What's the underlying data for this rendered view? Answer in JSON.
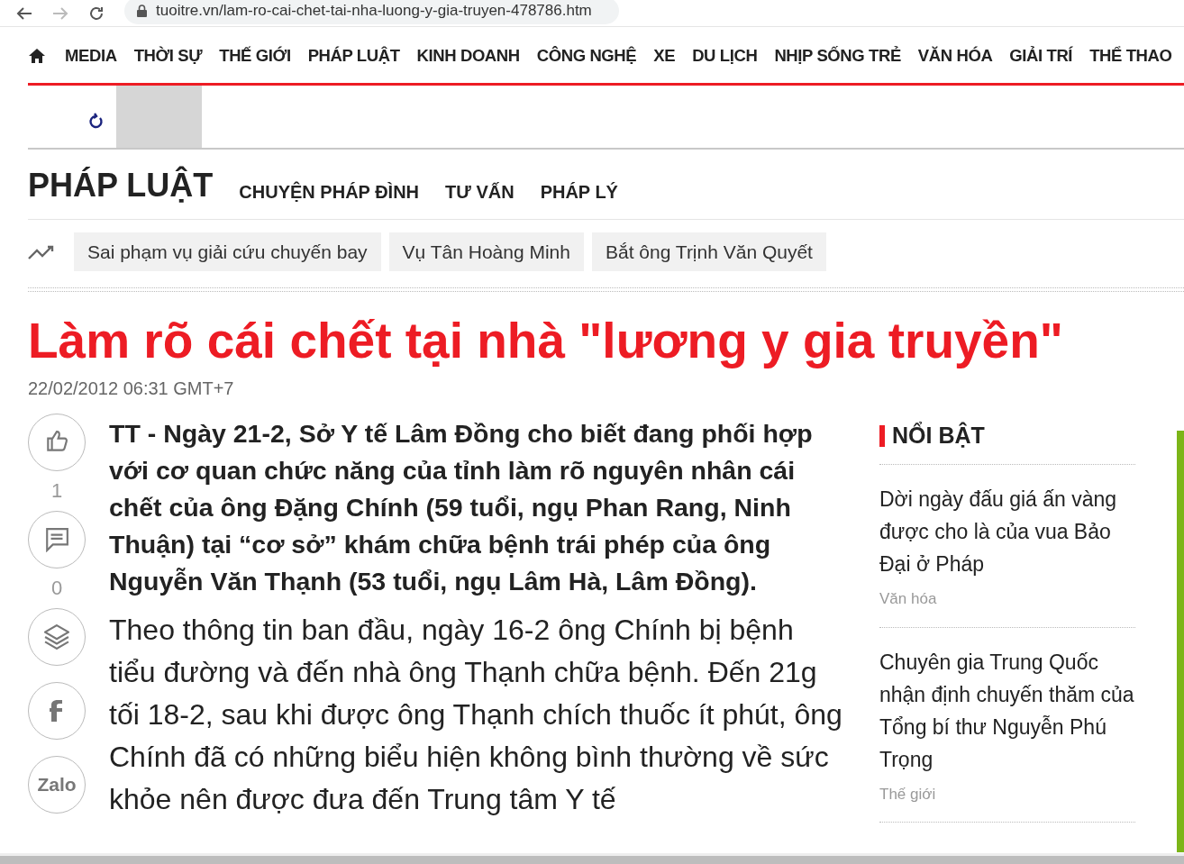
{
  "browser": {
    "url": "tuoitre.vn/lam-ro-cai-chet-tai-nha-luong-y-gia-truyen-478786.htm",
    "back_disabled": false,
    "forward_disabled": true
  },
  "nav": {
    "items": [
      "MEDIA",
      "THỜI SỰ",
      "THẾ GIỚI",
      "PHÁP LUẬT",
      "KINH DOANH",
      "CÔNG NGHỆ",
      "XE",
      "DU LỊCH",
      "NHỊP SỐNG TRẺ",
      "VĂN HÓA",
      "GIẢI TRÍ",
      "THỂ THAO"
    ]
  },
  "section": {
    "title": "PHÁP LUẬT",
    "subsections": [
      "CHUYỆN PHÁP ĐÌNH",
      "TƯ VẤN",
      "PHÁP LÝ"
    ]
  },
  "trending_tags": [
    "Sai phạm vụ giải cứu chuyến bay",
    "Vụ Tân Hoàng Minh",
    "Bắt ông Trịnh Văn Quyết"
  ],
  "article": {
    "title": "Làm rõ cái chết tại nhà \"lương y gia truyền\"",
    "date": "22/02/2012 06:31 GMT+7",
    "lead": "TT - Ngày 21-2, Sở Y tế Lâm Đồng cho biết đang phối hợp với cơ quan chức năng của tỉnh làm rõ nguyên nhân cái chết của ông Đặng Chính (59 tuổi, ngụ Phan Rang, Ninh Thuận) tại “cơ sở” khám chữa bệnh trái phép của ông Nguyễn Văn Thạnh (53 tuổi, ngụ Lâm Hà, Lâm Đồng).",
    "body": "Theo thông tin ban đầu, ngày 16-2 ông Chính bị bệnh tiểu đường và đến nhà ông Thạnh chữa bệnh. Đến 21g tối 18-2, sau khi được ông Thạnh chích thuốc ít phút, ông Chính đã có những biểu hiện không bình thường về sức khỏe nên được đưa đến Trung tâm Y tế"
  },
  "share_bar": [
    {
      "kind": "like",
      "count": "1"
    },
    {
      "kind": "comment",
      "count": "0"
    },
    {
      "kind": "layers"
    },
    {
      "kind": "facebook"
    },
    {
      "kind": "zalo",
      "label": "Zalo"
    }
  ],
  "featured": {
    "title": "NỔI BẬT",
    "items": [
      {
        "title": "Dời ngày đấu giá ấn vàng được cho là của vua Bảo Đại ở Pháp",
        "category": "Văn hóa"
      },
      {
        "title": "Chuyên gia Trung Quốc nhận định chuyến thăm của Tổng bí thư Nguyễn Phú Trọng",
        "category": "Thế giới"
      }
    ]
  }
}
